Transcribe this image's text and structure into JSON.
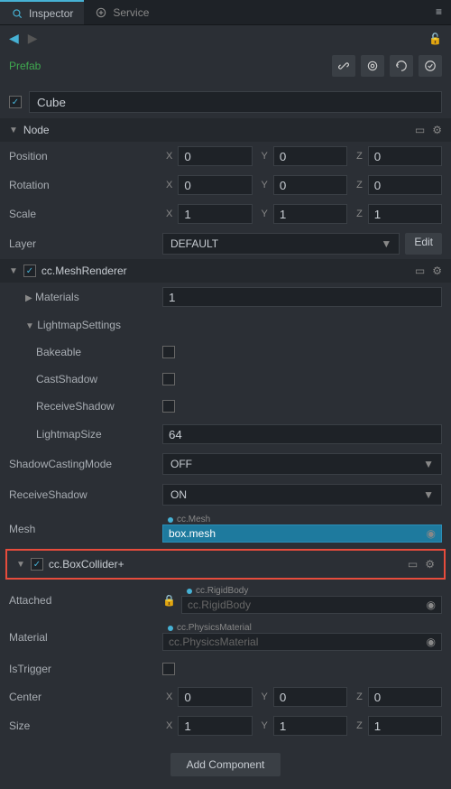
{
  "tabs": {
    "inspector": "Inspector",
    "service": "Service"
  },
  "prefab": {
    "label": "Prefab"
  },
  "nodeName": "Cube",
  "sections": {
    "node": {
      "title": "Node",
      "position": {
        "label": "Position",
        "x": "0",
        "y": "0",
        "z": "0"
      },
      "rotation": {
        "label": "Rotation",
        "x": "0",
        "y": "0",
        "z": "0"
      },
      "scale": {
        "label": "Scale",
        "x": "1",
        "y": "1",
        "z": "1"
      },
      "layer": {
        "label": "Layer",
        "value": "DEFAULT",
        "edit": "Edit"
      }
    },
    "meshRenderer": {
      "title": "cc.MeshRenderer",
      "materials": {
        "label": "Materials",
        "value": "1"
      },
      "lightmap": {
        "title": "LightmapSettings",
        "bakeable": "Bakeable",
        "castShadow": "CastShadow",
        "receiveShadow": "ReceiveShadow",
        "lightmapSize": {
          "label": "LightmapSize",
          "value": "64"
        }
      },
      "shadowCasting": {
        "label": "ShadowCastingMode",
        "value": "OFF"
      },
      "recvShadow": {
        "label": "ReceiveShadow",
        "value": "ON"
      },
      "mesh": {
        "label": "Mesh",
        "type": "cc.Mesh",
        "value": "box.mesh"
      }
    },
    "boxCollider": {
      "title": "cc.BoxCollider+",
      "attached": {
        "label": "Attached",
        "type": "cc.RigidBody",
        "value": "cc.RigidBody"
      },
      "material": {
        "label": "Material",
        "type": "cc.PhysicsMaterial",
        "value": "cc.PhysicsMaterial"
      },
      "isTrigger": "IsTrigger",
      "center": {
        "label": "Center",
        "x": "0",
        "y": "0",
        "z": "0"
      },
      "size": {
        "label": "Size",
        "x": "1",
        "y": "1",
        "z": "1"
      }
    }
  },
  "addComponent": "Add Component",
  "axes": {
    "x": "X",
    "y": "Y",
    "z": "Z"
  }
}
